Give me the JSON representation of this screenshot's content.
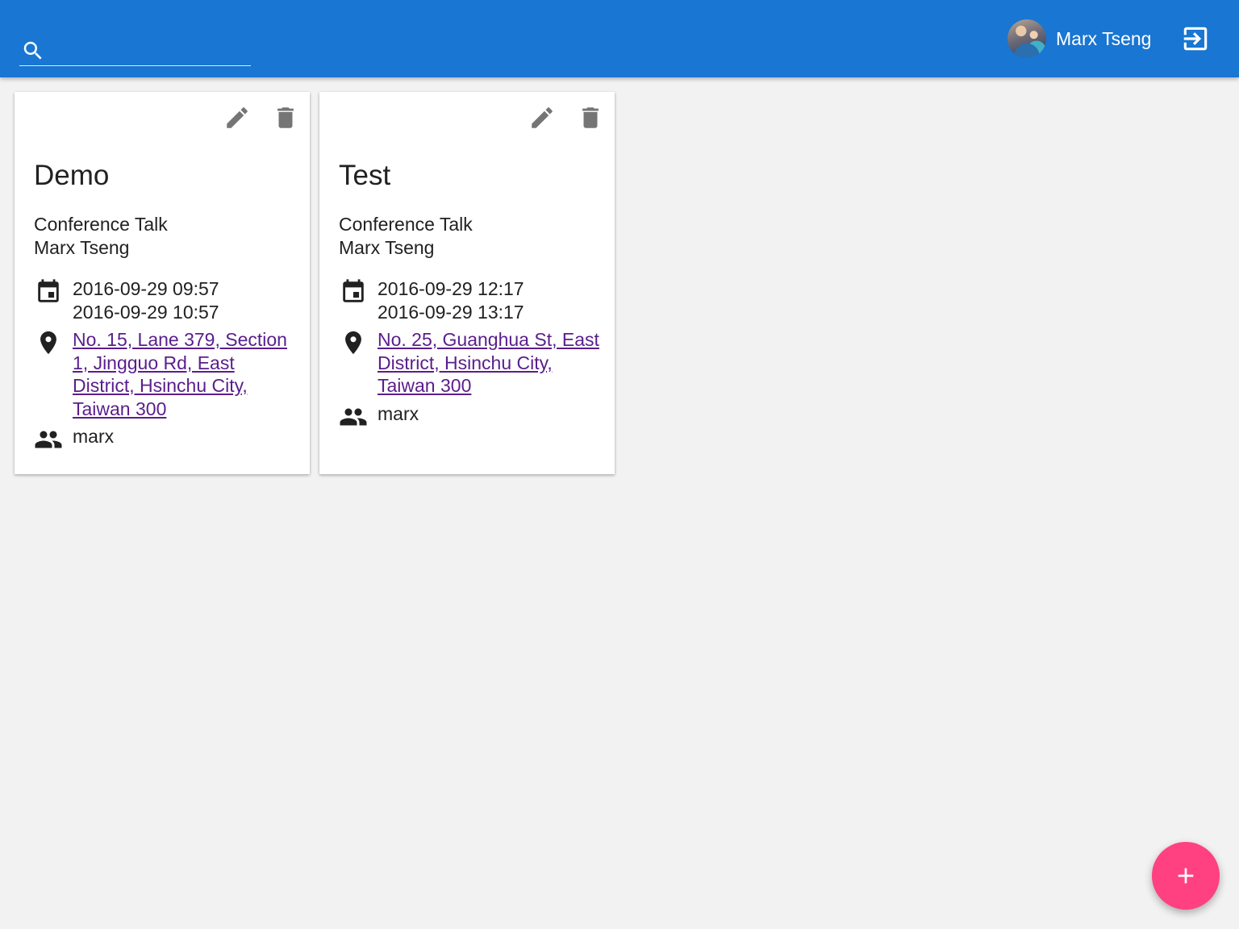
{
  "header": {
    "search_placeholder": "",
    "user_name": "Marx Tseng",
    "search_icon": "search-icon",
    "logout_icon": "exit-to-app-icon",
    "bar_color": "#1976d2"
  },
  "cards": [
    {
      "title": "Demo",
      "type": "Conference Talk",
      "speaker": "Marx Tseng",
      "start": "2016-09-29 09:57",
      "end": "2016-09-29 10:57",
      "address": "No. 15, Lane 379, Section 1, Jingguo Rd, East District, Hsinchu City, Taiwan 300",
      "attendees": "marx"
    },
    {
      "title": "Test",
      "type": "Conference Talk",
      "speaker": "Marx Tseng",
      "start": "2016-09-29 12:17",
      "end": "2016-09-29 13:17",
      "address": "No. 25, Guanghua St, East District, Hsinchu City, Taiwan 300",
      "attendees": "marx"
    }
  ],
  "fab": {
    "icon": "plus-icon",
    "color": "#ff4081"
  }
}
